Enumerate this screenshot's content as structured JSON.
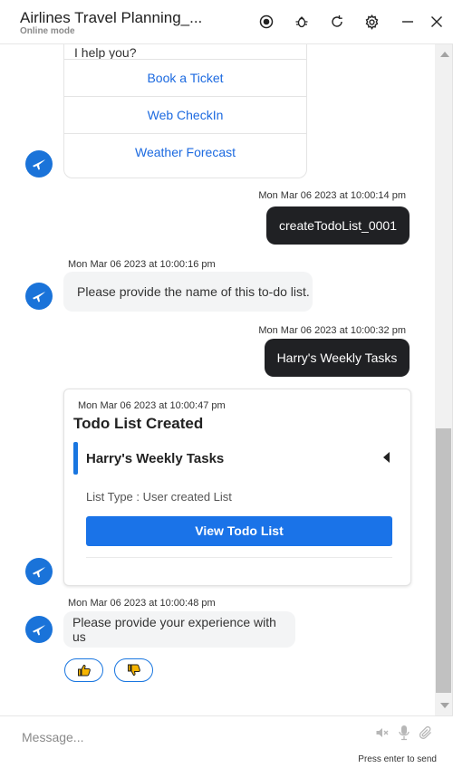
{
  "header": {
    "title": "Airlines Travel Planning_...",
    "subtitle": "Online mode",
    "icons": [
      "record-icon",
      "bug-icon",
      "refresh-icon",
      "settings-icon",
      "minimize-icon",
      "close-icon"
    ]
  },
  "menu": {
    "question": "I help you?",
    "options": [
      "Book a Ticket",
      "Web CheckIn",
      "Weather Forecast"
    ]
  },
  "messages": {
    "user1": {
      "time": "Mon Mar 06 2023 at 10:00:14 pm",
      "text": "createTodoList_0001"
    },
    "bot1": {
      "time": "Mon Mar 06 2023 at 10:00:16 pm",
      "text": "Please provide the name of this to-do list."
    },
    "user2": {
      "time": "Mon Mar 06 2023 at 10:00:32 pm",
      "text": "Harry's Weekly Tasks"
    },
    "bot3": {
      "time": "Mon Mar 06 2023 at 10:00:48 pm",
      "text": "Please provide your experience with us"
    }
  },
  "todo_card": {
    "time": "Mon Mar 06 2023 at 10:00:47 pm",
    "heading": "Todo List Created",
    "list_name": "Harry's Weekly Tasks",
    "list_type": "List Type : User created List",
    "button_label": "View Todo List"
  },
  "feedback": {
    "icons": [
      "thumbs-up-icon",
      "thumbs-down-icon"
    ]
  },
  "composer": {
    "placeholder": "Message...",
    "hint": "Press enter to send",
    "icons": [
      "speaker-muted-icon",
      "microphone-icon",
      "attachment-icon"
    ]
  },
  "colors": {
    "accent": "#1a73e8",
    "user_bubble": "#202124",
    "bot_bubble": "#f3f4f5",
    "link": "#1c6ae0"
  }
}
